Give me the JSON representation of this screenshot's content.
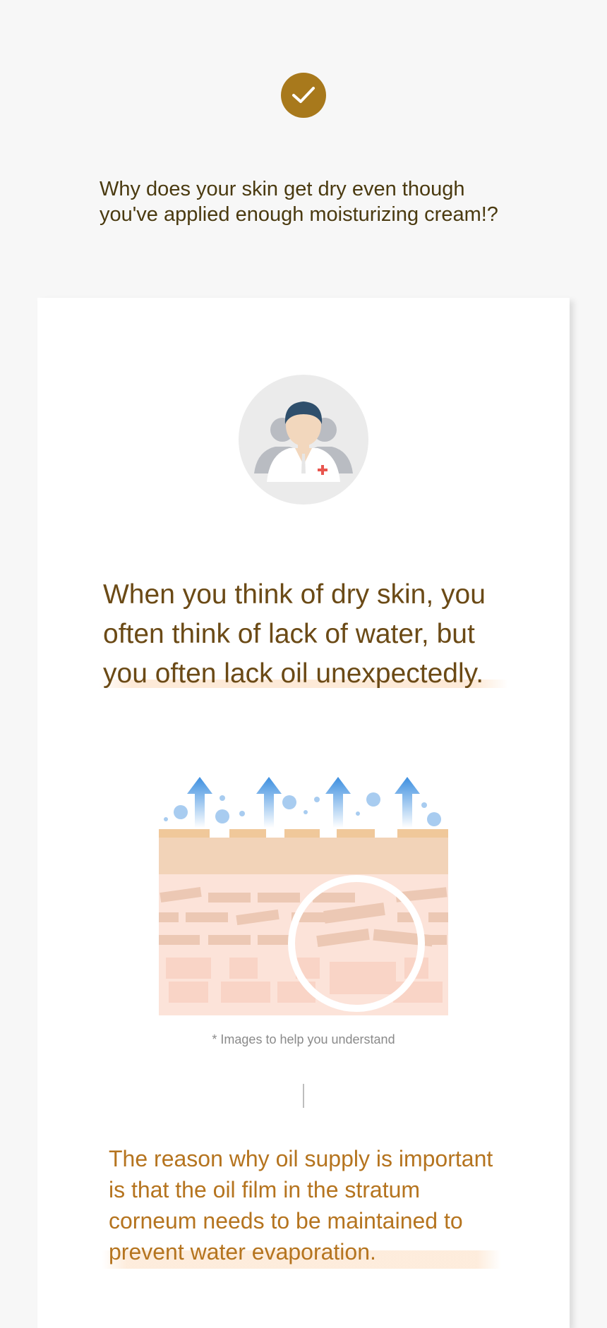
{
  "header": {
    "check_icon": "check-icon",
    "intro_line_1": "Why does your skin get dry even though",
    "intro_line_2": "you've applied enough moisturizing cream!?"
  },
  "card": {
    "avatar_icon": "doctor-icon",
    "headline_line_1": "When you think of dry skin, you",
    "headline_line_2": "often think of lack of water, but",
    "headline_line_3": "you often lack oil unexpectedly.",
    "illustration_icon": "skin-layer-evaporation-icon",
    "caption": "* Images to help you understand",
    "reason_line_1": "The reason why oil supply is important",
    "reason_line_2": "is that the oil film in the stratum",
    "reason_line_3": "corneum needs to be maintained to",
    "reason_line_4": "prevent water evaporation."
  },
  "colors": {
    "accent_gold": "#a8791c",
    "headline_brown": "#6b4a16",
    "reason_orange": "#b5741f",
    "arrow_blue": "#3d8fe0",
    "skin_peach": "#fbe2d6"
  }
}
